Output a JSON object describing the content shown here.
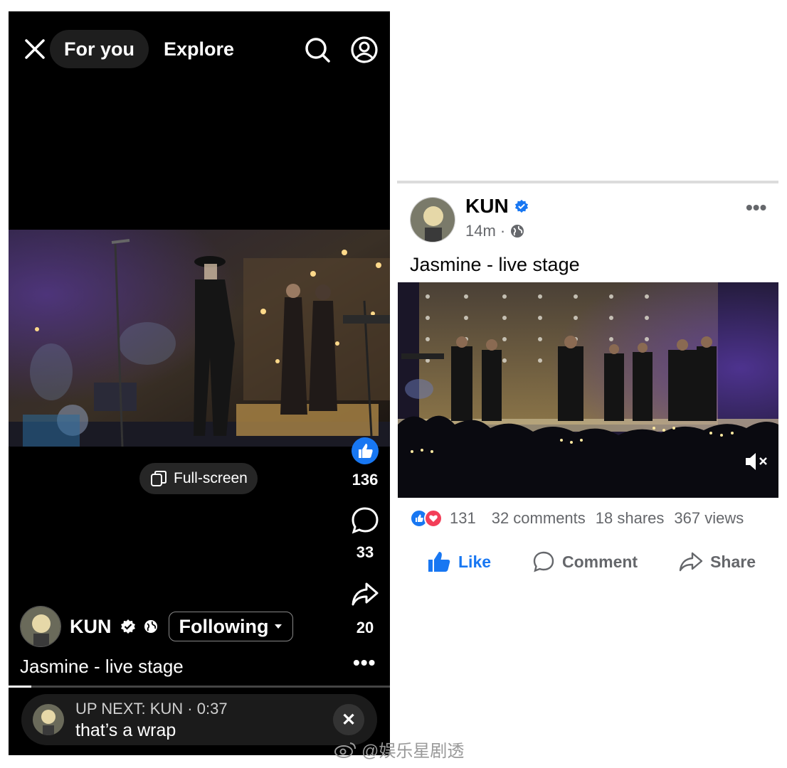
{
  "reel": {
    "close_icon": "close-icon",
    "tabs": {
      "for_you": "For you",
      "explore": "Explore"
    },
    "search_icon": "search-icon",
    "profile_icon": "profile-icon",
    "fullscreen_label": "Full-screen",
    "rail": {
      "likes": "136",
      "comments": "33",
      "shares": "20"
    },
    "author": {
      "name": "KUN",
      "follow_label": "Following"
    },
    "caption": "Jasmine - live stage",
    "progress": 0.06,
    "up_next": {
      "title": "UP NEXT: KUN · 0:37",
      "text": "that’s a wrap"
    }
  },
  "post": {
    "author": "KUN",
    "time": "14m ·",
    "caption": "Jasmine - live stage",
    "stats": {
      "reactions": "131",
      "comments": "32 comments",
      "shares": "18 shares",
      "views": "367 views"
    },
    "actions": {
      "like": "Like",
      "comment": "Comment",
      "share": "Share"
    }
  },
  "watermark": "@娱乐星剧透",
  "colors": {
    "facebook_blue": "#1877f2",
    "love_red": "#f33e58",
    "reel_bg": "#000000"
  }
}
